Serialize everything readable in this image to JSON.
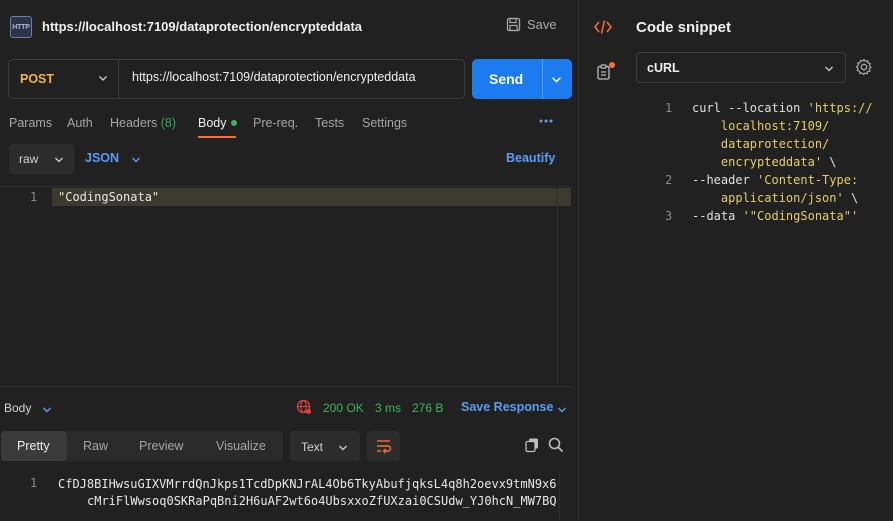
{
  "request": {
    "title_url": "https://localhost:7109/dataprotection/encrypteddata",
    "save_label": "Save",
    "method": "POST",
    "url": "https://localhost:7109/dataprotection/encrypteddata",
    "send_label": "Send",
    "tabs": [
      {
        "label": "Params"
      },
      {
        "label": "Auth"
      },
      {
        "label": "Headers",
        "count": "(8)"
      },
      {
        "label": "Body"
      },
      {
        "label": "Pre-req."
      },
      {
        "label": "Tests"
      },
      {
        "label": "Settings"
      }
    ],
    "body_mode": "raw",
    "body_format": "JSON",
    "beautify_label": "Beautify",
    "editor": {
      "line_number": "1",
      "content": "\"CodingSonata\""
    }
  },
  "response": {
    "section_label": "Body",
    "status": "200 OK",
    "time": "3 ms",
    "size": "276 B",
    "save_response_label": "Save Response",
    "tabs": [
      {
        "label": "Pretty"
      },
      {
        "label": "Raw"
      },
      {
        "label": "Preview"
      },
      {
        "label": "Visualize"
      }
    ],
    "format": "Text",
    "line_number": "1",
    "body_line1": "CfDJ8BIHwsuGIXVMrrdQnJkps1TcdDpKNJrAL4Ob6TkyAbufjqksL4q8h2oevx9tmN9x6",
    "body_line2": "cMriFlWwsoq0SKRaPqBni2H6uAF2wt6o4UbsxxoZfUXzai0CSUdw_YJ0hcN_MW7BQ"
  },
  "snippet": {
    "title": "Code snippet",
    "language": "cURL",
    "lines": [
      {
        "num": "1",
        "parts": [
          "curl --location ",
          "'https://"
        ]
      },
      {
        "num": "",
        "parts": [
          "    localhost:7109/"
        ]
      },
      {
        "num": "",
        "parts": [
          "    dataprotection/"
        ]
      },
      {
        "num": "",
        "parts": [
          "    encrypteddata'",
          " \\"
        ]
      },
      {
        "num": "2",
        "parts": [
          "--header ",
          "'Content-Type:"
        ]
      },
      {
        "num": "",
        "parts": [
          "    application/json'",
          " \\"
        ]
      },
      {
        "num": "3",
        "parts": [
          "--data ",
          "'\"CodingSonata\"'"
        ]
      }
    ]
  },
  "colors": {
    "accent": "#ff6c37",
    "send": "#1b7bef",
    "link": "#5b9cf5",
    "success": "#3cb55c",
    "method": "#f2b544",
    "string": "#e6cd69"
  }
}
